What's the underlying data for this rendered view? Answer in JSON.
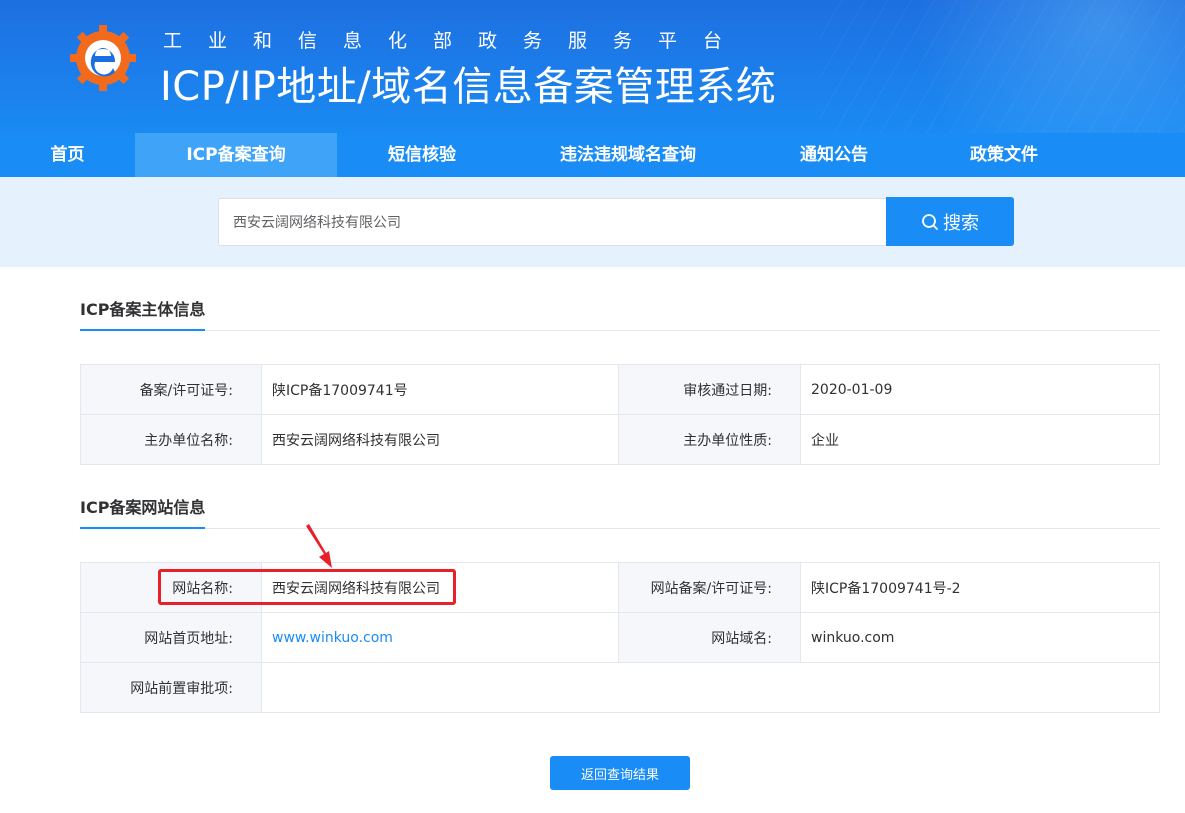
{
  "header": {
    "subtitle": "工业和信息化部政务服务平台",
    "title": "ICP/IP地址/域名信息备案管理系统",
    "logo_icon": "gear-e-logo-icon"
  },
  "nav": {
    "items": [
      {
        "label": "首页"
      },
      {
        "label": "ICP备案查询"
      },
      {
        "label": "短信核验"
      },
      {
        "label": "违法违规域名查询"
      },
      {
        "label": "通知公告"
      },
      {
        "label": "政策文件"
      }
    ],
    "active_index": 1
  },
  "search": {
    "value": "西安云阔网络科技有限公司",
    "button_label": "搜索",
    "button_icon": "search-icon"
  },
  "subject_section": {
    "title": "ICP备案主体信息",
    "rows": [
      {
        "label1": "备案/许可证号:",
        "value1": "陕ICP备17009741号",
        "label2": "审核通过日期:",
        "value2": "2020-01-09"
      },
      {
        "label1": "主办单位名称:",
        "value1": "西安云阔网络科技有限公司",
        "label2": "主办单位性质:",
        "value2": "企业"
      }
    ]
  },
  "website_section": {
    "title": "ICP备案网站信息",
    "rows": [
      {
        "label1": "网站名称:",
        "value1": "西安云阔网络科技有限公司",
        "label2": "网站备案/许可证号:",
        "value2": "陕ICP备17009741号-2"
      },
      {
        "label1": "网站首页地址:",
        "value1": "www.winkuo.com",
        "label2": "网站域名:",
        "value2": "winkuo.com"
      },
      {
        "label1": "网站前置审批项:",
        "value1": ""
      }
    ]
  },
  "back_button": {
    "label": "返回查询结果"
  },
  "colors": {
    "primary": "#1a8cf5",
    "highlight": "#e8202a",
    "search_bg": "#e5f1fc"
  }
}
